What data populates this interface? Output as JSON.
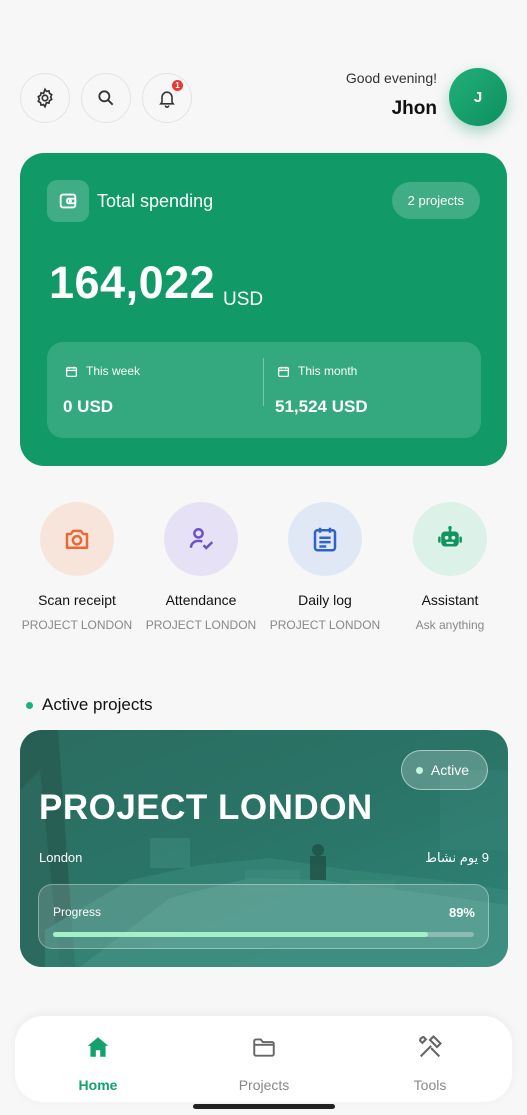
{
  "header": {
    "greeting": "Good evening!",
    "user_name": "Jhon",
    "avatar_initial": "J",
    "notification_count": "1"
  },
  "spending": {
    "title": "Total spending",
    "projects_pill": "2 projects",
    "amount": "164,022",
    "currency": "USD",
    "this_week_label": "This week",
    "this_week_value": "0 USD",
    "this_month_label": "This month",
    "this_month_value": "51,524 USD"
  },
  "actions": [
    {
      "label": "Scan receipt",
      "sub": "PROJECT LONDON",
      "icon": "camera-icon"
    },
    {
      "label": "Attendance",
      "sub": "PROJECT LONDON",
      "icon": "user-check-icon"
    },
    {
      "label": "Daily log",
      "sub": "PROJECT LONDON",
      "icon": "calendar-log-icon"
    },
    {
      "label": "Assistant",
      "sub": "Ask anything",
      "icon": "robot-icon"
    }
  ],
  "active_projects": {
    "section_title": "Active projects",
    "project": {
      "status": "Active",
      "name": "PROJECT LONDON",
      "city": "London",
      "days_active": "9 يوم نشاط",
      "progress_label": "Progress",
      "progress_text": "89%",
      "progress_value": 0.89
    }
  },
  "nav": {
    "home": "Home",
    "projects": "Projects",
    "tools": "Tools"
  },
  "colors": {
    "brand_green": "#119968",
    "accent_green": "#13a26d",
    "badge_red": "#e53935"
  }
}
